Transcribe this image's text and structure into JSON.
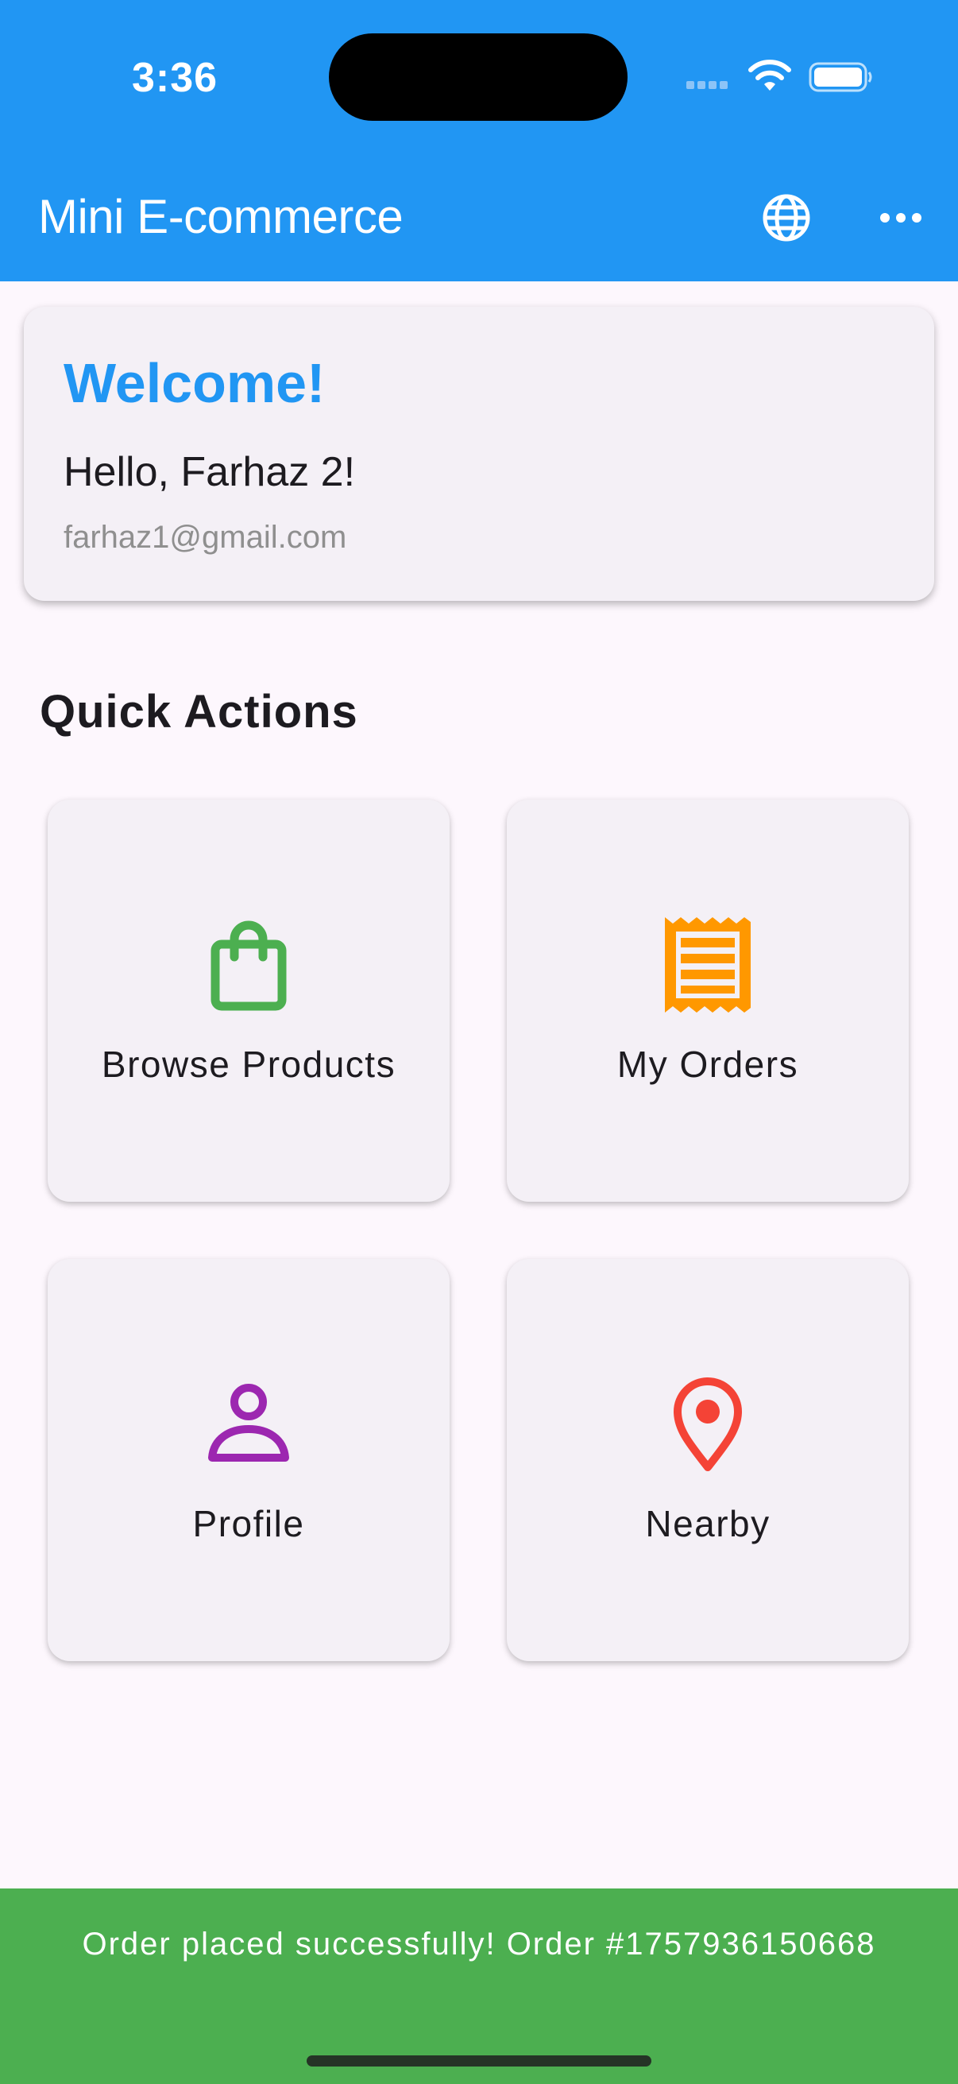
{
  "status_bar": {
    "time": "3:36"
  },
  "app_bar": {
    "title": "Mini E-commerce",
    "actions": [
      {
        "icon": "globe-icon"
      },
      {
        "icon": "more-horizontal-icon"
      }
    ]
  },
  "welcome": {
    "title": "Welcome!",
    "greeting": "Hello, Farhaz 2!",
    "email": "farhaz1@gmail.com"
  },
  "quick_actions": {
    "title": "Quick Actions",
    "tiles": [
      {
        "label": "Browse Products",
        "icon": "shopping-bag-icon",
        "color": "#4CAF50"
      },
      {
        "label": "My Orders",
        "icon": "receipt-icon",
        "color": "#FF9800"
      },
      {
        "label": "Profile",
        "icon": "person-icon",
        "color": "#9C27B0"
      },
      {
        "label": "Nearby",
        "icon": "location-pin-icon",
        "color": "#F44336"
      }
    ]
  },
  "snackbar": {
    "message": "Order placed successfully! Order #1757936150668",
    "color": "#4CAF50"
  },
  "colors": {
    "primary": "#2196F3",
    "background": "#FDF7FD",
    "card": "#F4F0F6"
  }
}
